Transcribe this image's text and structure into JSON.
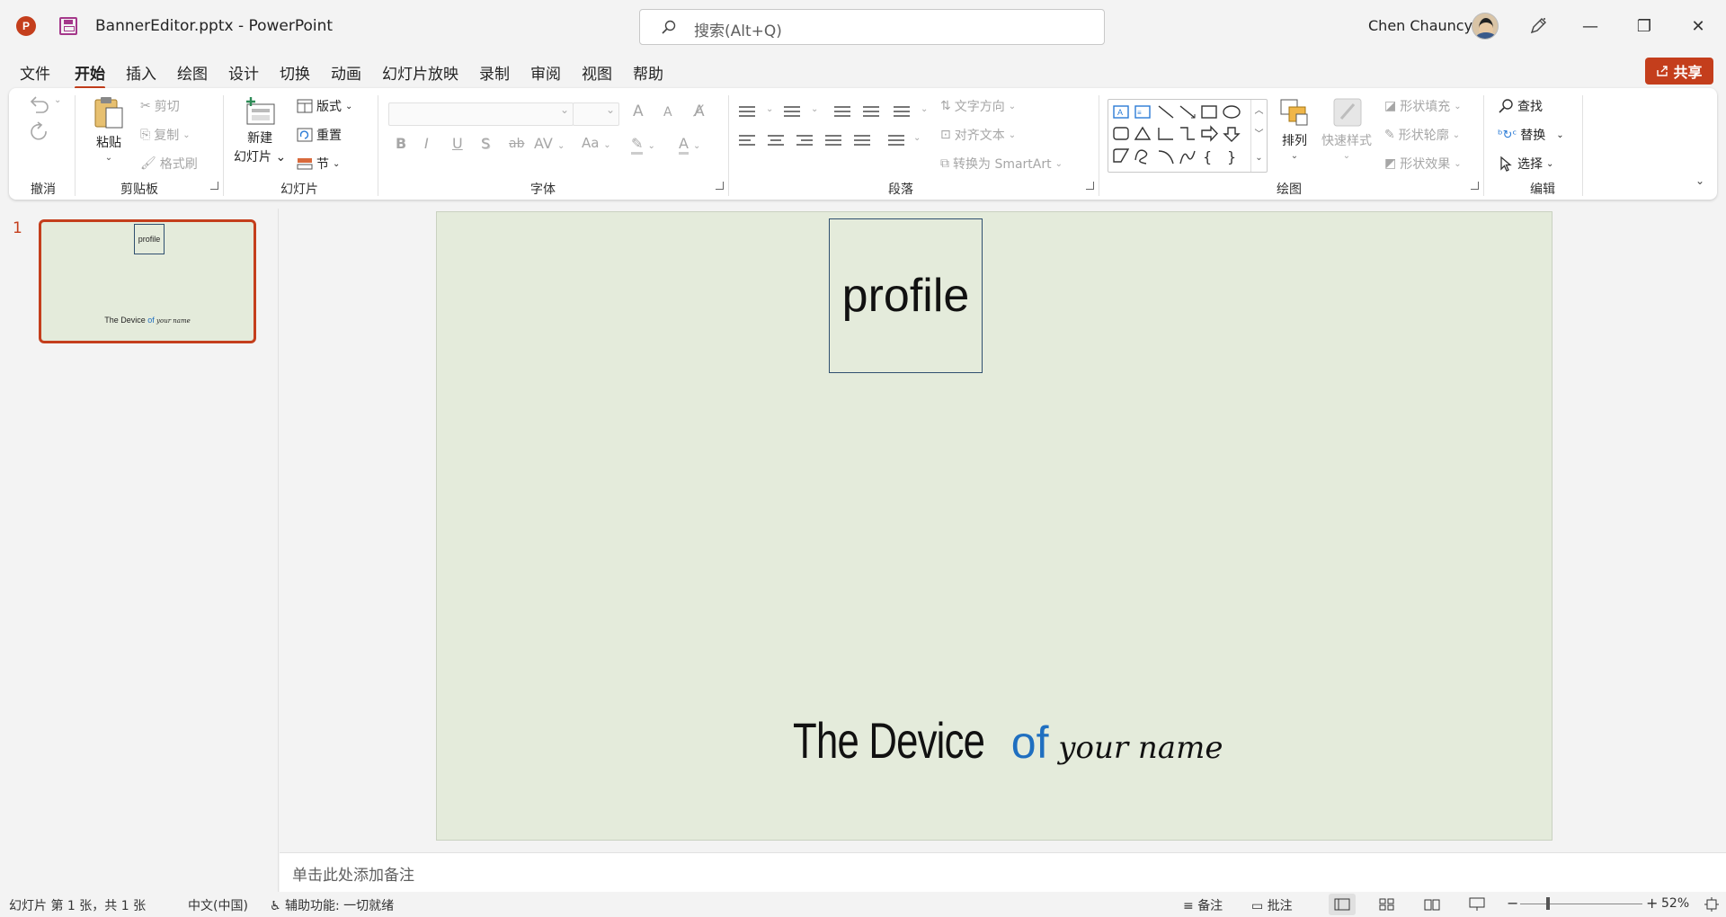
{
  "titlebar": {
    "app_logo": "P",
    "doc_title": "BannerEditor.pptx  -  PowerPoint",
    "search_placeholder": "搜索(Alt+Q)",
    "user_name": "Chen Chauncy",
    "min": "—",
    "max": "❐",
    "close": "✕"
  },
  "menu": {
    "tabs": [
      "文件",
      "开始",
      "插入",
      "绘图",
      "设计",
      "切换",
      "动画",
      "幻灯片放映",
      "录制",
      "审阅",
      "视图",
      "帮助"
    ],
    "active": "开始",
    "share": "共享"
  },
  "ribbon": {
    "groups": {
      "undo": "撤消",
      "clipboard": "剪贴板",
      "slides": "幻灯片",
      "font": "字体",
      "paragraph": "段落",
      "drawing": "绘图",
      "editing": "编辑"
    },
    "clipboard": {
      "paste": "粘贴",
      "cut": "剪切",
      "copy": "复制",
      "format_painter": "格式刷"
    },
    "slides": {
      "new_slide_1": "新建",
      "new_slide_2": "幻灯片",
      "layout": "版式",
      "reset": "重置",
      "section": "节"
    },
    "font": {
      "grow": "A",
      "shrink": "A",
      "bold": "B",
      "italic": "I",
      "underline": "U",
      "shadow": "S",
      "strike": "ab",
      "spacing": "AV",
      "case": "Aa",
      "color": "A"
    },
    "paragraph": {
      "text_direction": "文字方向",
      "align_text": "对齐文本",
      "smartart": "转换为 SmartArt"
    },
    "drawing": {
      "arrange": "排列",
      "quick_styles": "快速样式",
      "shape_fill": "形状填充",
      "shape_outline": "形状轮廓",
      "shape_effects": "形状效果"
    },
    "editing": {
      "find": "查找",
      "replace": "替换",
      "select": "选择"
    }
  },
  "slide_pane": {
    "slide_number": "1",
    "thumb_profile": "profile",
    "thumb_caption_main": "The Device ",
    "thumb_caption_of": "of",
    "thumb_caption_name": " your name"
  },
  "slide": {
    "profile_text": "profile",
    "caption_main": "The Device ",
    "caption_of": "of",
    "caption_name": " your name",
    "accent_color": "#1f6fc0",
    "background_color": "#e4ebdb"
  },
  "notes": {
    "placeholder": "单击此处添加备注"
  },
  "status": {
    "slide_info": "幻灯片 第 1 张，共 1 张",
    "language": "中文(中国)",
    "accessibility": "辅助功能: 一切就绪",
    "notes_btn": "备注",
    "comments_btn": "批注",
    "zoom_minus": "−",
    "zoom_plus": "+",
    "zoom_level": "52%"
  },
  "colors": {
    "brand": "#c43e1c",
    "ribbon_bg": "#ffffff",
    "app_bg": "#f3f3f3"
  }
}
